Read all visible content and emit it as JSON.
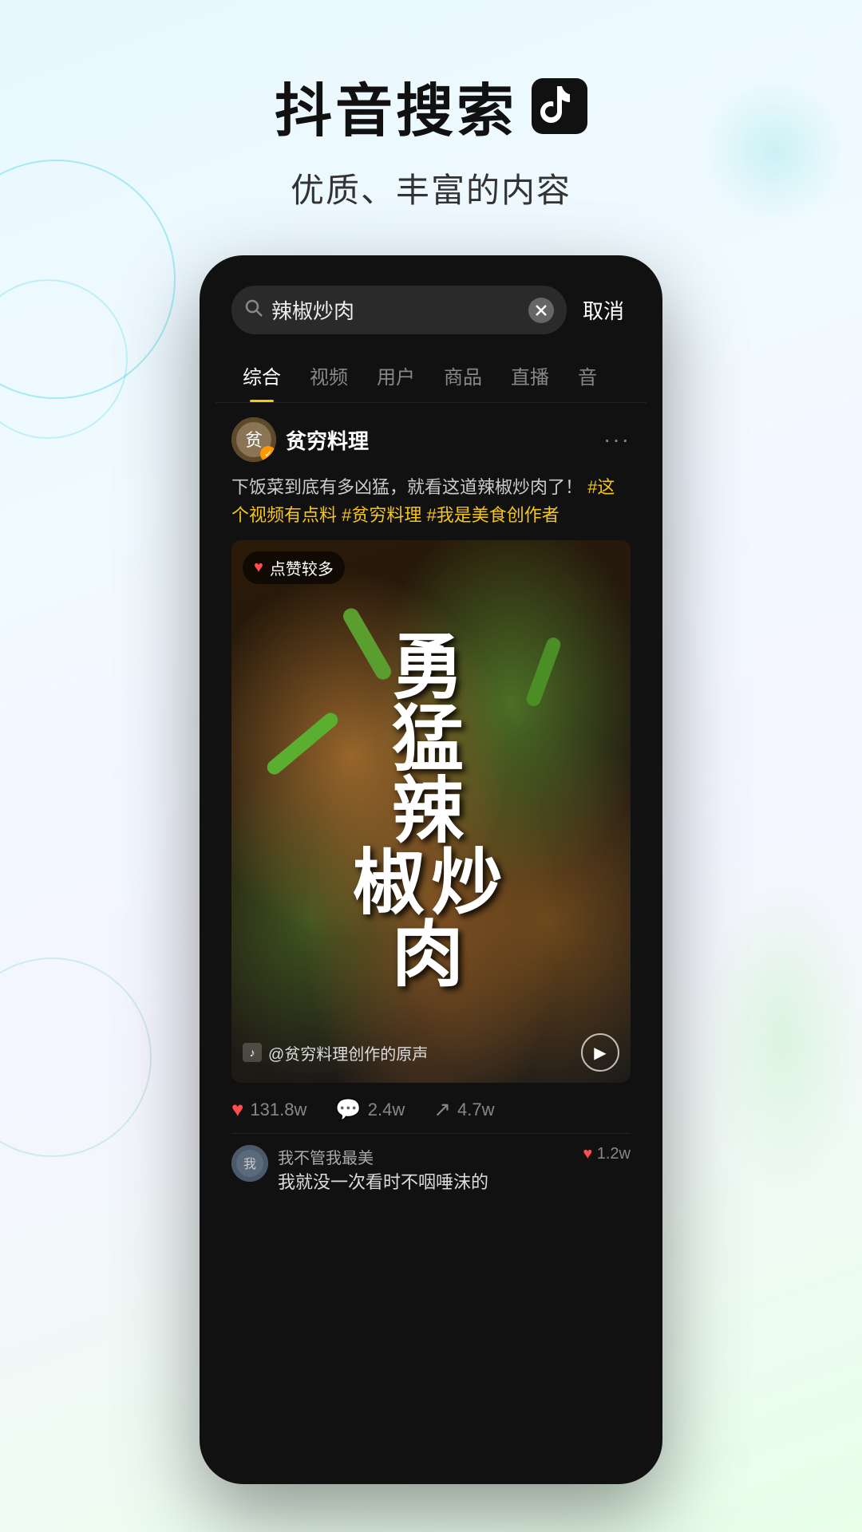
{
  "page": {
    "background": "gradient",
    "title": "抖音搜索",
    "tiktok_icon": "🎵",
    "subtitle": "优质、丰富的内容"
  },
  "phone": {
    "search_bar": {
      "query": "辣椒炒肉",
      "placeholder": "辣椒炒肉",
      "cancel_label": "取消"
    },
    "tabs": [
      {
        "label": "综合",
        "active": true
      },
      {
        "label": "视频",
        "active": false
      },
      {
        "label": "用户",
        "active": false
      },
      {
        "label": "商品",
        "active": false
      },
      {
        "label": "直播",
        "active": false
      },
      {
        "label": "音",
        "active": false
      }
    ],
    "post": {
      "username": "贫穷料理",
      "avatar_char": "贫",
      "verified": true,
      "more": "···",
      "description": "下饭菜到底有多凶猛，就看这道辣椒炒肉了！",
      "hashtags": [
        "#这个视频有点料",
        "#贫穷料理",
        "#我是美食创作者"
      ],
      "video": {
        "badge": "点赞较多",
        "title_lines": [
          "勇",
          "猛",
          "辣",
          "椒炒",
          "肉"
        ],
        "title_text": "勇猛辣椒炒肉",
        "audio": "@贫穷料理创作的原声"
      },
      "stats": {
        "likes": "131.8w",
        "comments": "2.4w",
        "shares": "4.7w"
      },
      "comments": [
        {
          "username": "我不管我最美",
          "text": "我就没一次看时不咽唾沫的",
          "likes": "1.2w"
        }
      ]
    }
  }
}
